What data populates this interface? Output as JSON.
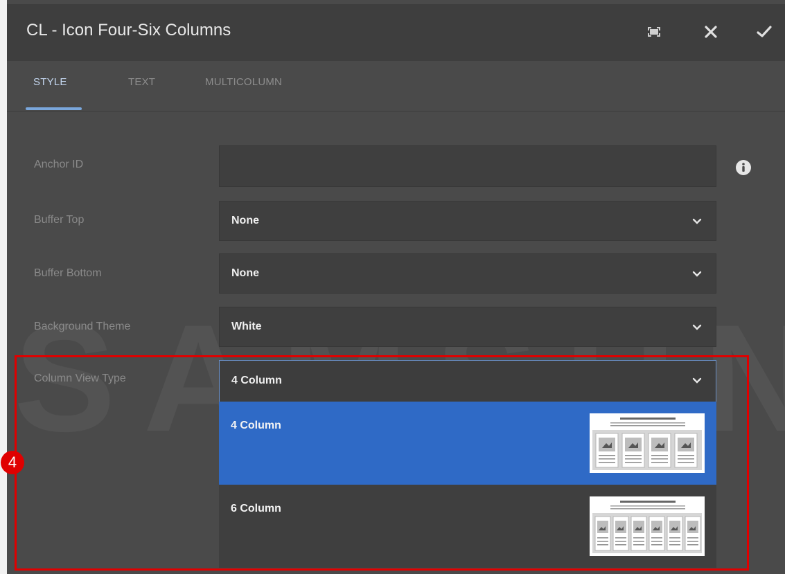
{
  "dialog": {
    "title": "CL - Icon Four-Six Columns"
  },
  "header_actions": [
    {
      "name": "fullscreen-button",
      "icon": "fullscreen-icon"
    },
    {
      "name": "close-button",
      "icon": "close-icon"
    },
    {
      "name": "confirm-button",
      "icon": "checkmark-icon"
    }
  ],
  "tabs": [
    {
      "label": "STYLE",
      "active": true
    },
    {
      "label": "TEXT",
      "active": false
    },
    {
      "label": "MULTICOLUMN",
      "active": false
    }
  ],
  "fields": {
    "anchor_id": {
      "label": "Anchor ID",
      "value": ""
    },
    "buffer_top": {
      "label": "Buffer Top",
      "value": "None"
    },
    "buffer_bottom": {
      "label": "Buffer Bottom",
      "value": "None"
    },
    "background_theme": {
      "label": "Background Theme",
      "value": "White"
    },
    "column_view_type": {
      "label": "Column View Type",
      "value": "4 Column",
      "options": [
        {
          "label": "4 Column",
          "selected": true,
          "thumb": "4-column-layout-thumbnail"
        },
        {
          "label": "6 Column",
          "selected": false,
          "thumb": "6-column-layout-thumbnail"
        }
      ]
    }
  },
  "annotation": {
    "badge": "4",
    "color": "#e00000"
  },
  "colors": {
    "accent": "#2f6ac6",
    "tab_active": "#7aa7dc",
    "background": "#4a4a4a",
    "header": "#3e3e3e"
  }
}
